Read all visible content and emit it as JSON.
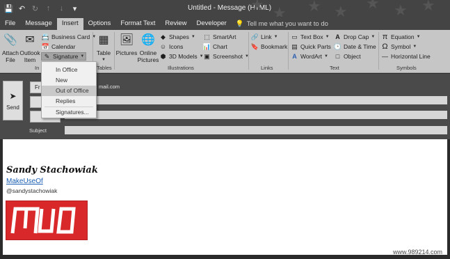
{
  "window": {
    "title": "Untitled - Message (HTML)"
  },
  "tabs": [
    {
      "label": "File"
    },
    {
      "label": "Message"
    },
    {
      "label": "Insert"
    },
    {
      "label": "Options"
    },
    {
      "label": "Format Text"
    },
    {
      "label": "Review"
    },
    {
      "label": "Developer"
    }
  ],
  "tell_me": "Tell me what you want to do",
  "ribbon": {
    "attach_file": "Attach\nFile",
    "outlook_item": "Outlook\nItem",
    "business_card": "Business Card",
    "calendar": "Calendar",
    "signature": "Signature",
    "include_group": "In",
    "table": "Table",
    "tables_group": "Tables",
    "pictures": "Pictures",
    "online_pictures": "Online\nPictures",
    "shapes": "Shapes",
    "icons": "Icons",
    "models_3d": "3D Models",
    "smartart": "SmartArt",
    "chart": "Chart",
    "screenshot": "Screenshot",
    "illustrations_group": "Illustrations",
    "link": "Link",
    "bookmark": "Bookmark",
    "links_group": "Links",
    "text_box": "Text Box",
    "quick_parts": "Quick Parts",
    "wordart": "WordArt",
    "drop_cap": "Drop Cap",
    "date_time": "Date & Time",
    "object": "Object",
    "text_group": "Text",
    "equation": "Equation",
    "symbol": "Symbol",
    "horizontal_line": "Horizontal Line",
    "symbols_group": "Symbols"
  },
  "signature_menu": [
    "In Office",
    "New",
    "Out of Office",
    "Replies",
    "Signatures..."
  ],
  "signature_menu_selected": "Out of Office",
  "fields": {
    "send": "Send",
    "from_button": "Fr",
    "from_address_partial": "mail.com",
    "subject_label": "Subject"
  },
  "body": {
    "name": "Sandy Stachowiak",
    "link": "MakeUseOf",
    "handle": "@sandystachowiak",
    "logo_text": "MUO",
    "logo_color": "#d8282a"
  },
  "watermark": "www.989214.com",
  "colors": {
    "titlebar": "#444444",
    "ribbon": "#c6c6c6",
    "link": "#1a5fb4"
  }
}
